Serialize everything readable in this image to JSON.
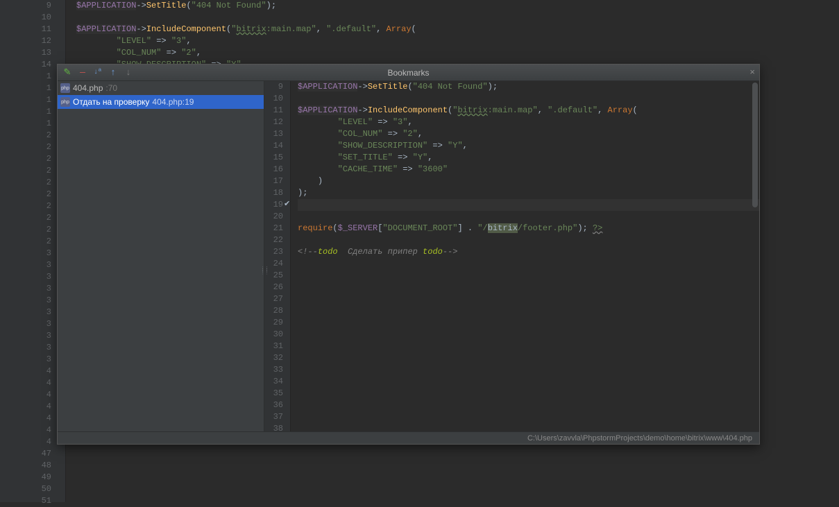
{
  "popup": {
    "title": "Bookmarks",
    "statusPath": "C:\\Users\\zavvla\\PhpstormProjects\\demo\\home\\bitrix\\www\\404.php"
  },
  "toolbar": {
    "edit_title": "Edit",
    "delete_title": "Delete",
    "sort_title": "Sort",
    "up_title": "Move Up",
    "down_title": "Move Down"
  },
  "bookmarks": [
    {
      "label": "404.php",
      "loc": ":70",
      "selected": false
    },
    {
      "label": "Отдать на проверку",
      "loc": "404.php:19",
      "selected": true
    }
  ],
  "bgLines": [
    "9",
    "10",
    "11",
    "12",
    "13",
    "14",
    "1",
    "1",
    "1",
    "1",
    "1",
    "2",
    "2",
    "2",
    "2",
    "2",
    "2",
    "2",
    "2",
    "2",
    "2",
    "3",
    "3",
    "3",
    "3",
    "3",
    "3",
    "3",
    "3",
    "3",
    "3",
    "4",
    "4",
    "4",
    "4",
    "4",
    "4",
    "4",
    "47",
    "48",
    "49",
    "50",
    "51"
  ],
  "previewLines": [
    "9",
    "10",
    "11",
    "12",
    "13",
    "14",
    "15",
    "16",
    "17",
    "18",
    "19",
    "20",
    "21",
    "22",
    "23",
    "24",
    "25",
    "26",
    "27",
    "28",
    "29",
    "30",
    "31",
    "32",
    "33",
    "34",
    "35",
    "36",
    "37",
    "38"
  ],
  "bgCode": {
    "l9": {
      "app": "$APPLICATION",
      "op": "->",
      "fn": "SetTitle",
      "p1": "(",
      "s": "\"404 Not Found\"",
      "p2": ");"
    },
    "l11": {
      "app": "$APPLICATION",
      "op": "->",
      "fn": "IncludeComponent",
      "p1": "(",
      "s1": "\"",
      "bit": "bitrix",
      "s1b": ":main.map\"",
      "c1": ", ",
      "s2": "\".default\"",
      "c2": ", ",
      "arr": "Array",
      "p2": "("
    },
    "l12": {
      "indent": "        ",
      "s": "\"LEVEL\"",
      "op": " => ",
      "v": "\"3\"",
      "c": ","
    },
    "l13": {
      "indent": "        ",
      "s": "\"COL_NUM\"",
      "op": " => ",
      "v": "\"2\"",
      "c": ","
    },
    "l14": {
      "indent": "        ",
      "s": "\"SHOW_DESCRIPTION\"",
      "op": " => ",
      "v": "\"Y\"",
      "c": ","
    }
  },
  "previewCode": {
    "l9": {
      "app": "$APPLICATION",
      "op": "->",
      "fn": "SetTitle",
      "p1": "(",
      "s": "\"404 Not Found\"",
      "p2": ");"
    },
    "l11": {
      "app": "$APPLICATION",
      "op": "->",
      "fn": "IncludeComponent",
      "p1": "(",
      "s1": "\"",
      "bit": "bitrix",
      "s1b": ":main.map\"",
      "c1": ", ",
      "s2": "\".default\"",
      "c2": ", ",
      "arr": "Array",
      "p2": "("
    },
    "l12": {
      "indent": "        ",
      "s": "\"LEVEL\"",
      "op": " => ",
      "v": "\"3\"",
      "c": ","
    },
    "l13": {
      "indent": "        ",
      "s": "\"COL_NUM\"",
      "op": " => ",
      "v": "\"2\"",
      "c": ","
    },
    "l14": {
      "indent": "        ",
      "s": "\"SHOW_DESCRIPTION\"",
      "op": " => ",
      "v": "\"Y\"",
      "c": ","
    },
    "l15": {
      "indent": "        ",
      "s": "\"SET_TITLE\"",
      "op": " => ",
      "v": "\"Y\"",
      "c": ","
    },
    "l16": {
      "indent": "        ",
      "s": "\"CACHE_TIME\"",
      "op": " => ",
      "v": "\"3600\"",
      "c": ""
    },
    "l17": {
      "indent": "    ",
      "p": ")"
    },
    "l18": {
      "p": ");"
    },
    "l21": {
      "req": "require",
      "p1": "(",
      "srv": "$_SERVER",
      "b1": "[",
      "s1": "\"DOCUMENT_ROOT\"",
      "b2": "] . ",
      "s2a": "\"/",
      "bit": "bitrix",
      "s2b": "/footer.php\"",
      "p2": "); ",
      "php": "?>"
    },
    "l23": {
      "c1": "<!--",
      "todo1": "todo",
      "txt": "  Сделать припер ",
      "todo2": "todo",
      "c2": "-->"
    }
  }
}
